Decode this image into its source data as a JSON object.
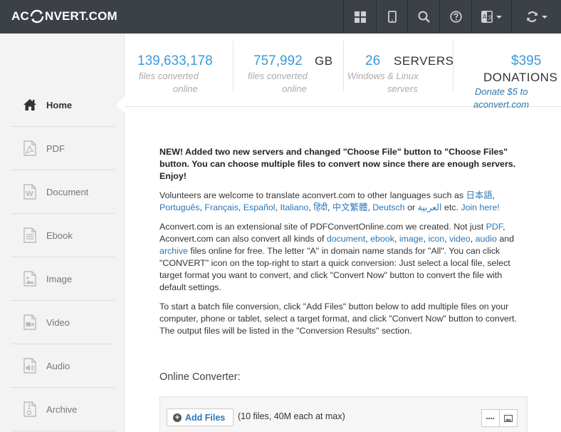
{
  "header": {
    "logo_prefix": "AC",
    "logo_suffix": "NVERT.COM",
    "icons": [
      "grid-icon",
      "tablet-icon",
      "search-icon",
      "help-icon",
      "language-icon",
      "convert-icon"
    ]
  },
  "stats": {
    "files": {
      "number": "139,633,178",
      "line1": "files converted",
      "line2": "online"
    },
    "size": {
      "number": "757,992",
      "unit": "GB",
      "line1": "files converted",
      "line2": "online"
    },
    "servers": {
      "number": "26",
      "unit": "SERVERS",
      "line1": "Windows & Linux",
      "line2": "servers"
    },
    "donations": {
      "number": "$395",
      "unit": "DONATIONS",
      "link1": "Donate $5 to",
      "link2": "aconvert.com"
    }
  },
  "sidebar": {
    "items": [
      {
        "label": "Home",
        "icon": "home-icon",
        "active": true
      },
      {
        "label": "PDF",
        "icon": "pdf-icon"
      },
      {
        "label": "Document",
        "icon": "document-icon"
      },
      {
        "label": "Ebook",
        "icon": "ebook-icon"
      },
      {
        "label": "Image",
        "icon": "image-icon"
      },
      {
        "label": "Video",
        "icon": "video-icon"
      },
      {
        "label": "Audio",
        "icon": "audio-icon"
      },
      {
        "label": "Archive",
        "icon": "archive-icon"
      }
    ]
  },
  "content": {
    "news": "NEW! Added two new servers and changed \"Choose File\" button to \"Choose Files\" button. You can choose multiple files to convert now since there are enough servers. Enjoy!",
    "p2": {
      "t1": "Volunteers are welcome to translate aconvert.com to other languages such as ",
      "lang1": "日本語",
      "lang2": "Português",
      "lang3": "Français",
      "lang4": "Español",
      "lang5": "Italiano",
      "lang6": "हिंदी",
      "lang7": "中文繁體",
      "lang8": "Deutsch",
      "t_or": " or ",
      "lang9": "العربية",
      "t_etc": " etc. ",
      "join": "Join here!"
    },
    "p3": {
      "t1": "Aconvert.com is an extensional site of PDFConvertOnline.com we created. Not just ",
      "pdf": "PDF",
      "t2": ", Aconvert.com can also convert all kinds of ",
      "document": "document",
      "ebook": "ebook",
      "image": "image",
      "icon": "icon",
      "video": "video",
      "audio": "audio",
      "t_and": " and ",
      "archive": "archive",
      "t3": " files online for free. The letter \"A\" in domain name stands for \"All\". You can click \"CONVERT\" icon on the top-right to start a quick conversion: Just select a local file, select target format you want to convert, and click \"Convert Now\" button to convert the file with default settings."
    },
    "p4": "To start a batch file conversion, click \"Add Files\" button below to add multiple files on your computer, phone or tablet, select a target format, and click \"Convert Now\" button to convert. The output files will be listed in the \"Conversion Results\" section."
  },
  "converter": {
    "title": "Online Converter:",
    "add_files": "Add Files",
    "limit": "(10 files, 40M each at max)",
    "view_icons": [
      "list-view-icon",
      "thumbnail-view-icon"
    ]
  }
}
